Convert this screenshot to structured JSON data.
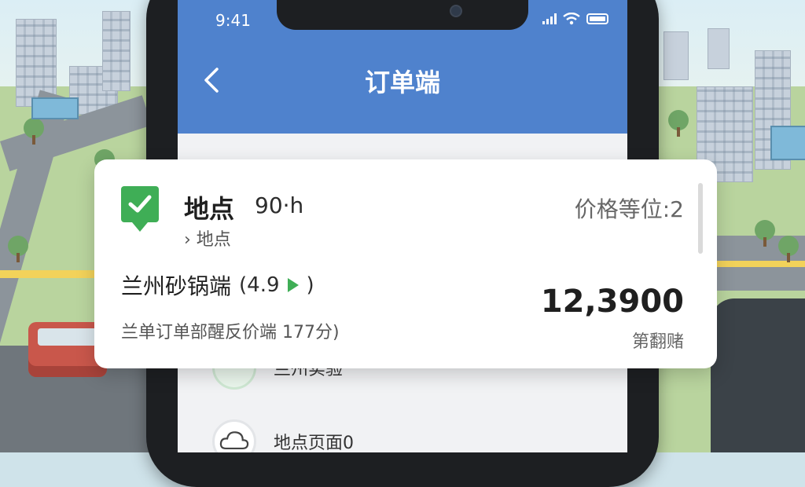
{
  "status_bar": {
    "time": "9:41"
  },
  "app_bar": {
    "title": "订单端"
  },
  "card": {
    "title": "地点",
    "hours": "90·h",
    "subtitle": "› 地点",
    "price_label": "价格等位:2",
    "store_name": "兰州砂锅端",
    "rating": "(4.9",
    "rating_close": ")",
    "description": "兰单订单部醒反价端  177分)",
    "amount": "12,3900",
    "amount_label": "第翻赌"
  },
  "list": [
    {
      "label": "兰州实验"
    },
    {
      "label": "地点页面0"
    }
  ],
  "colors": {
    "primary_blue": "#4f82cd",
    "accent_green": "#3fae56",
    "card_background": "#ffffff"
  },
  "icons": [
    "back-arrow-icon",
    "signal-icon",
    "wifi-icon",
    "battery-icon",
    "location-check-icon",
    "play-icon",
    "cloud-icon"
  ]
}
